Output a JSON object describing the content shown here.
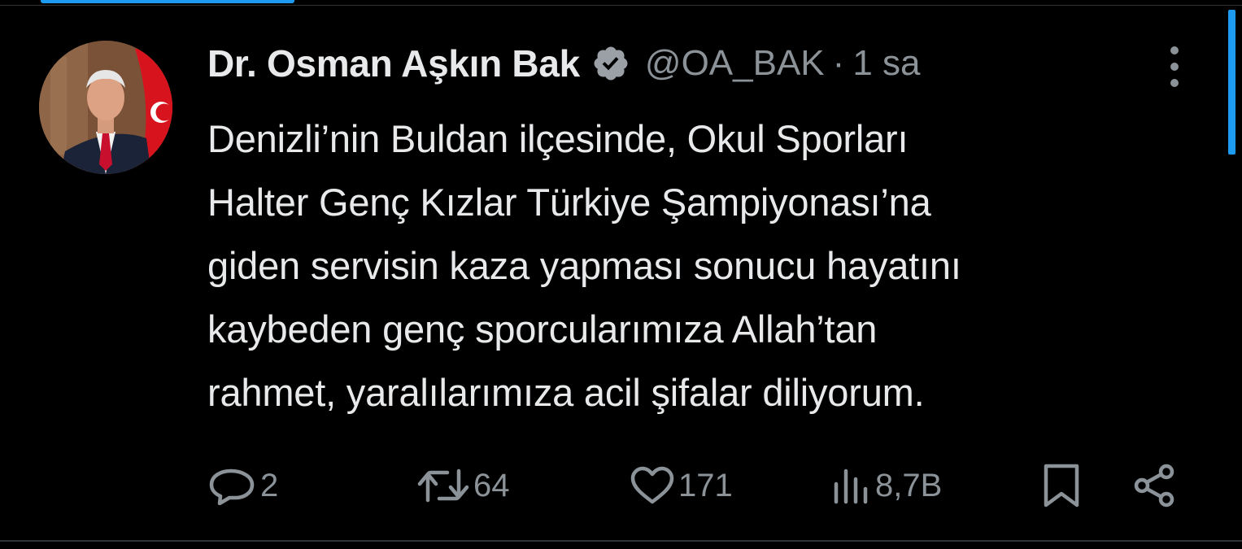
{
  "tweet": {
    "author": {
      "display_name": "Dr. Osman Aşkın Bak",
      "handle": "@OA_BAK",
      "verified_icon": "verified-badge-icon"
    },
    "separator": "·",
    "time": "1 sa",
    "text": "Denizli’nin Buldan ilçesinde, Okul Sporları\nHalter Genç Kızlar Türkiye Şampiyonası’na\ngiden servisin kaza yapması sonucu hayatını\nkaybeden genç sporcularımıza Allah’tan\nrahmet, yaralılarımıza acil şifalar diliyorum.",
    "actions": {
      "reply": {
        "icon": "reply-icon",
        "count": "2"
      },
      "retweet": {
        "icon": "retweet-icon",
        "count": "64"
      },
      "like": {
        "icon": "heart-icon",
        "count": "171"
      },
      "views": {
        "icon": "views-icon",
        "count": "8,7B"
      },
      "bookmark": {
        "icon": "bookmark-icon"
      },
      "share": {
        "icon": "share-icon"
      }
    }
  },
  "colors": {
    "background": "#000000",
    "text_primary": "#e7e9ea",
    "text_secondary": "#8b9298",
    "accent": "#1d9bf0",
    "divider": "#2f3336"
  }
}
